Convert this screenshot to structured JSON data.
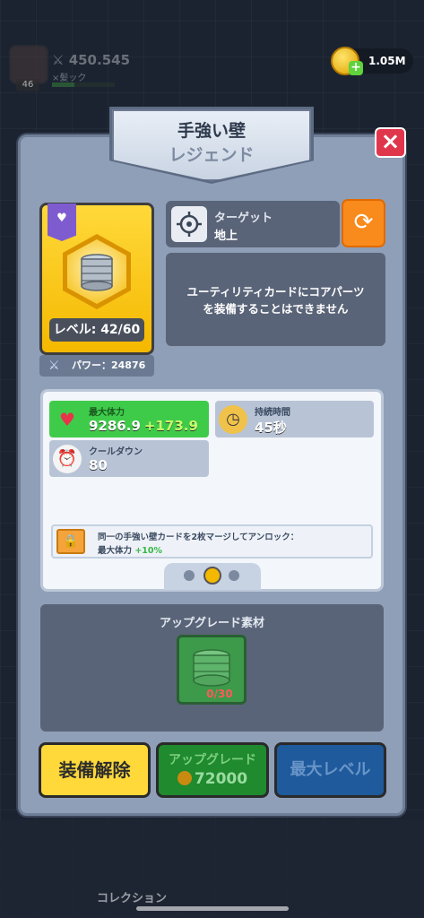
{
  "header": {
    "power_value": "450.545",
    "player_name": "×髪ック",
    "player_level": "46",
    "xp_fraction": 0.35,
    "coins": "1.05M"
  },
  "modal": {
    "title": "手強い壁",
    "rarity": "レジェンド",
    "close_icon": "×"
  },
  "card": {
    "level_text": "レベル: 42/60",
    "power_text": "パワー：24876",
    "ribbon_icon": "heart-chevron-icon"
  },
  "target": {
    "label": "ターゲット",
    "value": "地上"
  },
  "info_text_line1": "ユーティリティカードにコアパーツ",
  "info_text_line2": "を装備することはできません",
  "stats": {
    "hp_label": "最大体力",
    "hp_value": "9286.9",
    "hp_bonus": "+173.9",
    "duration_label": "持続時間",
    "duration_value": "45秒",
    "cooldown_label": "クールダウン",
    "cooldown_value": "80"
  },
  "unlock": {
    "line1": "同一の手強い壁カードを2枚マージしてアンロック：",
    "line2_prefix": "最大体力",
    "line2_bonus": "+10%"
  },
  "pager": {
    "pages": 3,
    "active": 1
  },
  "materials": {
    "title": "アップグレード素材",
    "count": "0/30"
  },
  "buttons": {
    "unequip": "装備解除",
    "upgrade": "アップグレード",
    "upgrade_cost": "72000",
    "max_level": "最大レベル"
  },
  "nav": {
    "collection_label": "コレクション"
  },
  "colors": {
    "accent_yellow": "#ffd93a",
    "close_red": "#e0364b",
    "hp_green": "#3fcb4a",
    "swap_orange": "#f98a1c"
  }
}
